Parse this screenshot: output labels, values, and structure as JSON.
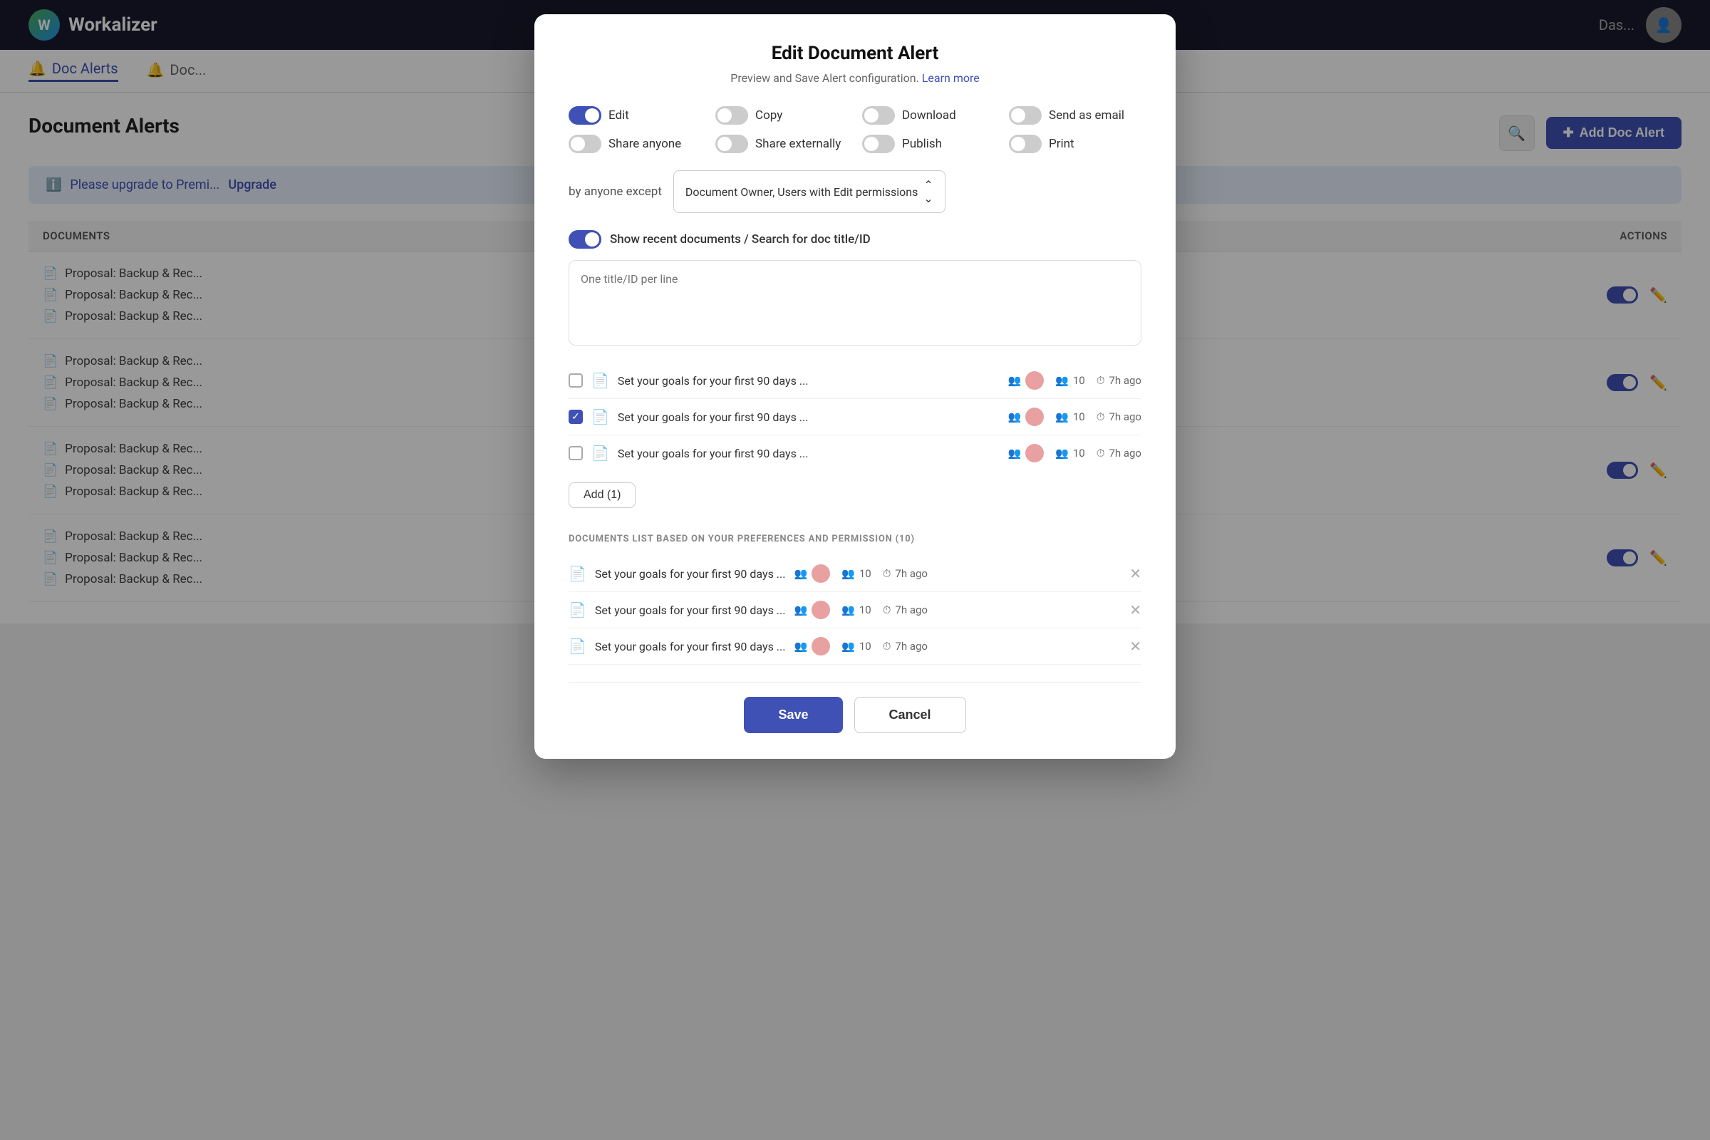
{
  "app": {
    "logo_text": "Workalizer",
    "header_tab": "Das..."
  },
  "tabs": [
    {
      "label": "Doc Alerts",
      "active": true
    },
    {
      "label": "Doc...",
      "active": false
    }
  ],
  "page": {
    "title": "Document Alerts",
    "upgrade_text": "Please upgrade to Premi...",
    "upgrade_link": "Upgrade"
  },
  "table": {
    "col_documents": "DOCUMENTS",
    "col_actions": "ACTIONS",
    "rows": [
      {
        "items": [
          "Proposal: Backup & Rec...",
          "Proposal: Backup & Rec...",
          "Proposal: Backup & Rec..."
        ]
      },
      {
        "items": [
          "Proposal: Backup & Rec...",
          "Proposal: Backup & Rec...",
          "Proposal: Backup & Rec..."
        ]
      },
      {
        "items": [
          "Proposal: Backup & Rec...",
          "Proposal: Backup & Rec...",
          "Proposal: Backup & Rec..."
        ]
      },
      {
        "items": [
          "Proposal: Backup & Rec...",
          "Proposal: Backup & Rec...",
          "Proposal: Backup & Rec..."
        ]
      }
    ]
  },
  "modal": {
    "title": "Edit Document Alert",
    "subtitle": "Preview and Save Alert configuration.",
    "learn_more": "Learn more",
    "actions": [
      {
        "label": "Edit",
        "on": true
      },
      {
        "label": "Copy",
        "on": false
      },
      {
        "label": "Download",
        "on": false
      },
      {
        "label": "Send as email",
        "on": false
      },
      {
        "label": "Share anyone",
        "on": false
      },
      {
        "label": "Share externally",
        "on": false
      },
      {
        "label": "Publish",
        "on": false
      },
      {
        "label": "Print",
        "on": false
      }
    ],
    "by_anyone_label": "by anyone except",
    "permissions_dropdown": "Document Owner, Users with Edit permissions",
    "show_recent_label": "Show recent documents / Search for doc title/ID",
    "show_recent_on": true,
    "textarea_placeholder": "One title/ID per line",
    "doc_list": [
      {
        "checked": false,
        "title": "Set your goals for your first 90 days ...",
        "members": 10,
        "time": "7h ago"
      },
      {
        "checked": true,
        "title": "Set your goals for your first 90 days ...",
        "members": 10,
        "time": "7h ago"
      },
      {
        "checked": false,
        "title": "Set your goals for your first 90 days ...",
        "members": 10,
        "time": "7h ago"
      }
    ],
    "add_btn": "Add (1)",
    "section_label": "DOCUMENTS LIST BASED ON YOUR PREFERENCES AND PERMISSION (10)",
    "selected_docs": [
      {
        "title": "Set your goals for your first 90 days ...",
        "members": 10,
        "time": "7h ago"
      },
      {
        "title": "Set your goals for your first 90 days ...",
        "members": 10,
        "time": "7h ago"
      },
      {
        "title": "Set your goals for your first 90 days ...",
        "members": 10,
        "time": "7h ago"
      }
    ],
    "save_btn": "Save",
    "cancel_btn": "Cancel"
  }
}
